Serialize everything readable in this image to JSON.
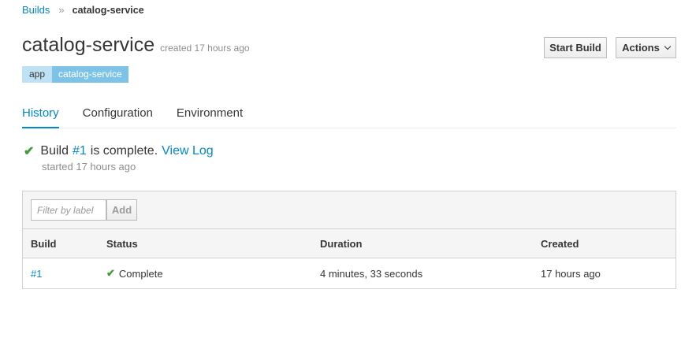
{
  "breadcrumb": {
    "parent": "Builds",
    "separator": "»",
    "current": "catalog-service"
  },
  "header": {
    "title": "catalog-service",
    "created": "created 17 hours ago"
  },
  "labels": [
    {
      "key": "app",
      "value": "catalog-service"
    }
  ],
  "buttons": {
    "start_build": "Start Build",
    "actions": "Actions"
  },
  "tabs": [
    {
      "label": "History",
      "active": true
    },
    {
      "label": "Configuration",
      "active": false
    },
    {
      "label": "Environment",
      "active": false
    }
  ],
  "status": {
    "prefix": "Build",
    "build_link": "#1",
    "suffix": "is complete.",
    "view_log": "View Log",
    "started": "started 17 hours ago",
    "icon": "check-icon",
    "color": "#3f9c35"
  },
  "filter": {
    "placeholder": "Filter by label",
    "add_label": "Add"
  },
  "table": {
    "headers": [
      "Build",
      "Status",
      "Duration",
      "Created"
    ],
    "rows": [
      {
        "build": "#1",
        "status": "Complete",
        "duration": "4 minutes, 33 seconds",
        "created": "17 hours ago"
      }
    ]
  },
  "colors": {
    "accent": "#0088ce",
    "success": "#3f9c35",
    "label_key_bg": "#bee1f4",
    "label_value_bg": "#7dc3e8"
  }
}
